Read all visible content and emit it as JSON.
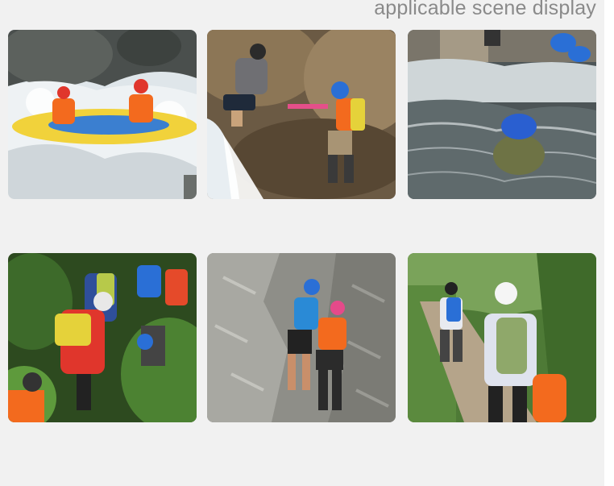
{
  "header": {
    "title": "applicable scene display"
  },
  "gallery": {
    "images": [
      {
        "icon": "rafting-photo"
      },
      {
        "icon": "rock-climbing-stream-photo"
      },
      {
        "icon": "floating-dry-bag-photo"
      },
      {
        "icon": "jungle-hikers-photo"
      },
      {
        "icon": "canyon-hikers-photo"
      },
      {
        "icon": "trail-hikers-photo"
      }
    ]
  },
  "colors": {
    "background": "#f1f1f1",
    "title": "#8a8a8a",
    "accent_orange": "#f36a1e",
    "accent_blue": "#2a6fd6"
  }
}
